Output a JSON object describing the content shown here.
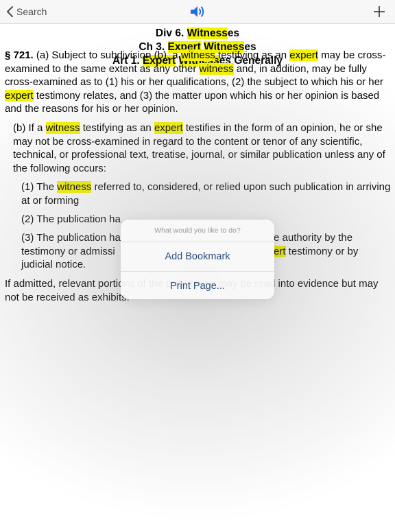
{
  "navbar": {
    "back_label": "Search",
    "speaker_icon": "speaker-icon",
    "add_icon": "plus-icon"
  },
  "heading": {
    "line1": {
      "hl": "Witness",
      "rest": "es",
      "prefix": "Div 6. "
    },
    "line2": {
      "prefix": "Ch 3. ",
      "hl1": "Expert",
      "space": " ",
      "hl2": "Witness",
      "rest": "es"
    },
    "line3": {
      "prefix": "Art 1. ",
      "hl1": "Expert",
      "space": " ",
      "hl2": "Witness",
      "rest": "es Generally"
    }
  },
  "section": {
    "number": "§ 721.",
    "t1": " (a) Subject to subdivision (b), a ",
    "w1": "witness",
    "t2": " testifying as an ",
    "e1": "expert",
    "t3": " may be cross-examined to the same extent as any other ",
    "w2": "witness",
    "t4": " and, in addition, may be fully cross-examined as to (1) his or her qualifications, (2) the subject to which his or her ",
    "e2": "expert",
    "t5": " testimony relates, and (3) the matter upon which his or her opinion is based and the reasons for his or her opinion."
  },
  "sub_b": {
    "t1": "(b) If a ",
    "w1": "witness",
    "t2": " testifying as an ",
    "e1": "expert",
    "t3": " testifies in the form of an opinion, he or she may not be cross-examined in regard to the content or tenor of any scientific, technical, or professional text, treatise, journal, or similar publication unless any of the following occurs:"
  },
  "item1": {
    "t1": "(1) The ",
    "w1": "witness",
    "t2": " referred to, considered, or relied upon such publication in arriving at or forming"
  },
  "item2": {
    "t1": "(2) The publication ha"
  },
  "item3": {
    "t1": "(3) The publication ha",
    "t1b": "e authority by the",
    "t2": "testimony or admissi",
    "e1": "ert",
    "t3": " testimony or by",
    "t4": "judicial notice."
  },
  "admitted": "If admitted, relevant portions of the publication may be read into evidence but may not be received as exhibits.",
  "popover": {
    "title": "What would you like to do?",
    "add_bookmark": "Add Bookmark",
    "print_page": "Print Page..."
  },
  "colors": {
    "highlight": "#f5f500",
    "popover_button": "#2a4f7a",
    "accent_icon": "#1f6fe0"
  }
}
